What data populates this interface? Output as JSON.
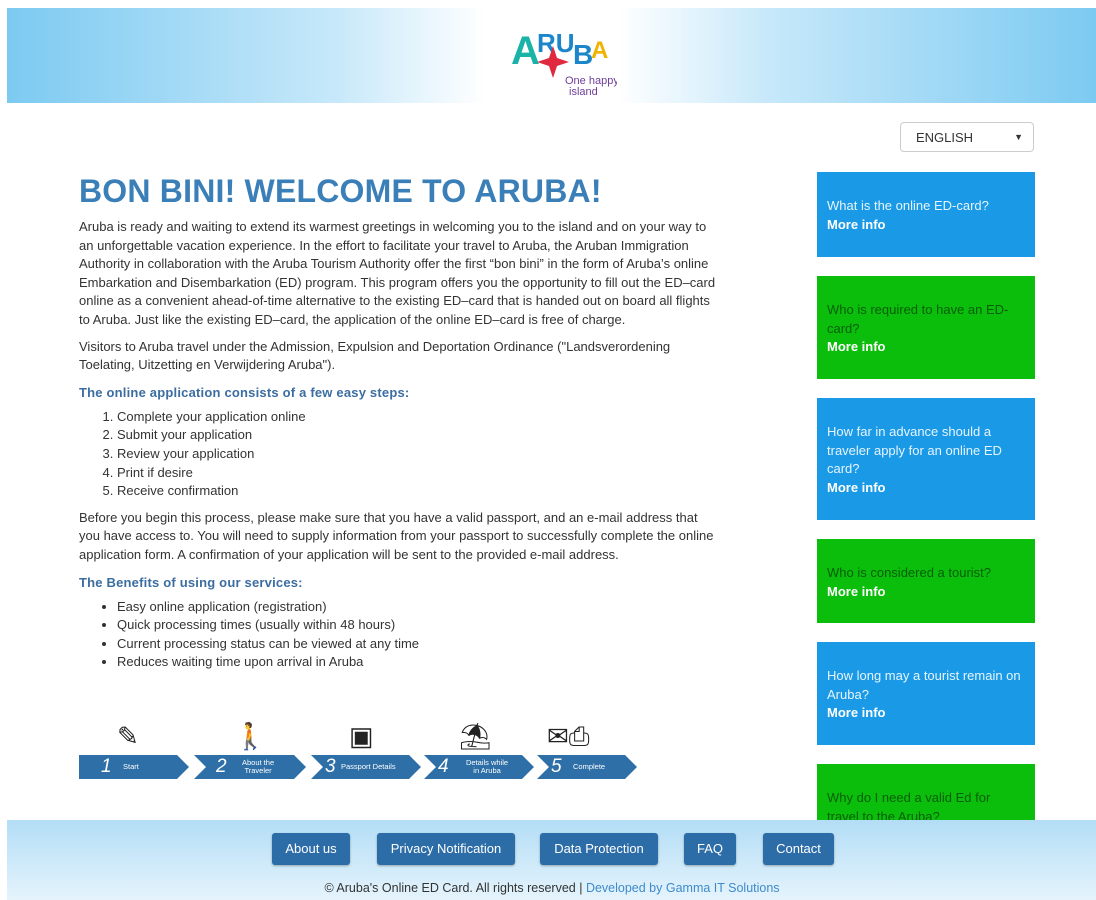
{
  "header": {
    "logo_text": "ARUBA",
    "logo_tagline_1": "One happy",
    "logo_tagline_2": "island"
  },
  "language": {
    "selected": "ENGLISH"
  },
  "main": {
    "title": "BON BINI! WELCOME TO ARUBA!",
    "intro": "Aruba is ready and waiting to extend its warmest greetings in welcoming you to the island and on your way to an unforgettable vacation experience. In the effort to facilitate your travel to Aruba, the Aruban Immigration Authority in collaboration with the Aruba Tourism Authority offer the first “bon bini” in the form of Aruba’s online Embarkation and Disembarkation (ED) program. This program offers you the opportunity to fill out the ED–card online as a convenient ahead-of-time alternative to the existing ED–card that is handed out on board all flights to Aruba. Just like the existing ED–card, the application of the online ED–card is free of charge.",
    "visitors": "Visitors to Aruba travel under the Admission, Expulsion and Deportation Ordinance (\"Landsverordening Toelating, Uitzetting en Verwijdering Aruba\").",
    "steps_heading": "The online application consists of a few easy steps:",
    "steps": [
      "Complete your application online",
      "Submit your application",
      "Review your application",
      "Print if desire",
      "Receive confirmation"
    ],
    "before": "Before you begin this process, please make sure that you have a valid passport, and an e-mail address that you have access to. You will need to supply information from your passport to successfully complete the online application form. A confirmation of your application will be sent to the provided e-mail address.",
    "benefits_heading": "The Benefits of using our services:",
    "benefits": [
      "Easy online application (registration)",
      "Quick processing times (usually within 48 hours)",
      "Current processing status can be viewed at any time",
      "Reduces waiting time upon arrival in Aruba"
    ]
  },
  "process": [
    {
      "num": "1",
      "label_1": "Start",
      "label_2": "",
      "icon": "pencil-icon"
    },
    {
      "num": "2",
      "label_1": "About the",
      "label_2": "Traveler",
      "icon": "traveler-icon"
    },
    {
      "num": "3",
      "label_1": "Passport Details",
      "label_2": "",
      "icon": "passport-icon"
    },
    {
      "num": "4",
      "label_1": "Details while",
      "label_2": "in Aruba",
      "icon": "beach-icon"
    },
    {
      "num": "5",
      "label_1": "Complete",
      "label_2": "",
      "icon": "mail-print-icon"
    }
  ],
  "sidebar": [
    {
      "question": "What is the online ED-card?",
      "more": "More info",
      "color": "#1a9ae6"
    },
    {
      "question": "Who is required to have an ED-card?",
      "more": "More info",
      "color": "#0bbe0b"
    },
    {
      "question": "How far in advance should a traveler apply for an online ED card?",
      "more": "More info",
      "color": "#1a9ae6"
    },
    {
      "question": "Who is considered a tourist?",
      "more": "More info",
      "color": "#0bbe0b"
    },
    {
      "question": "How long may a tourist remain on Aruba?",
      "more": "More info",
      "color": "#1a9ae6"
    },
    {
      "question": "Why do I need a valid Ed for travel to the Aruba?",
      "more": "",
      "color": "#0bbe0b"
    }
  ],
  "footer": {
    "buttons": [
      "About us",
      "Privacy Notification",
      "Data Protection",
      "FAQ",
      "Contact"
    ],
    "copyright": "©  Aruba's Online ED Card. All rights reserved |",
    "developer": "Developed by Gamma IT Solutions"
  }
}
